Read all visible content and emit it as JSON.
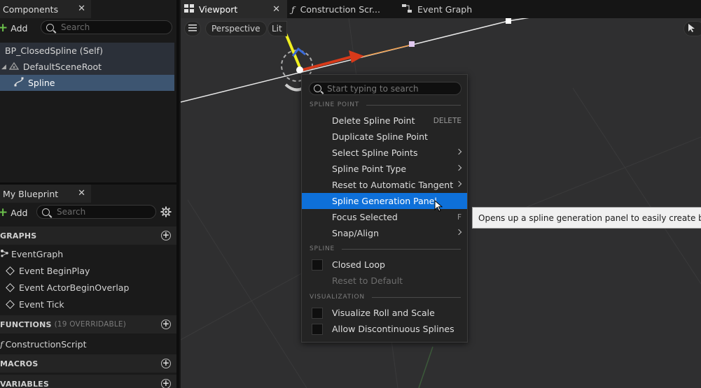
{
  "components_panel": {
    "tab_label": "Components",
    "add_label": "Add",
    "search_placeholder": "Search",
    "tree": [
      {
        "label": "BP_ClosedSpline (Self)"
      },
      {
        "label": "DefaultSceneRoot"
      },
      {
        "label": "Spline"
      }
    ]
  },
  "my_blueprint_panel": {
    "tab_label": "My Blueprint",
    "add_label": "Add",
    "search_placeholder": "Search",
    "sections": {
      "graphs": {
        "label": "GRAPHS",
        "items": [
          "EventGraph"
        ]
      },
      "events": [
        "Event BeginPlay",
        "Event ActorBeginOverlap",
        "Event Tick"
      ],
      "functions": {
        "label": "FUNCTIONS",
        "sublabel": "(19 OVERRIDABLE)",
        "items": [
          "ConstructionScript"
        ]
      },
      "macros": {
        "label": "MACROS"
      },
      "variables": {
        "label": "VARIABLES"
      }
    }
  },
  "editor_tabs": [
    {
      "label": "Viewport",
      "icon": "grid-icon",
      "active": true
    },
    {
      "label": "Construction Scr...",
      "icon": "function-icon",
      "active": false
    },
    {
      "label": "Event Graph",
      "icon": "graph-icon",
      "active": false
    }
  ],
  "viewport_toolbar": {
    "perspective_label": "Perspective",
    "lit_label": "Lit"
  },
  "context_menu": {
    "search_placeholder": "Start typing to search",
    "sections": [
      {
        "label": "SPLINE POINT"
      },
      {
        "label": "SPLINE"
      },
      {
        "label": "VISUALIZATION"
      }
    ],
    "items": {
      "delete": {
        "label": "Delete Spline Point",
        "shortcut": "DELETE"
      },
      "duplicate": {
        "label": "Duplicate Spline Point"
      },
      "select": {
        "label": "Select Spline Points"
      },
      "type": {
        "label": "Spline Point Type"
      },
      "reset_tangent": {
        "label": "Reset to Automatic Tangent"
      },
      "generation_panel": {
        "label": "Spline Generation Panel"
      },
      "focus": {
        "label": "Focus Selected",
        "shortcut": "F"
      },
      "snap": {
        "label": "Snap/Align"
      },
      "closed_loop": {
        "label": "Closed Loop",
        "checked": false
      },
      "reset_default": {
        "label": "Reset to Default"
      },
      "roll_scale": {
        "label": "Visualize Roll and Scale",
        "checked": false
      },
      "discontinuous": {
        "label": "Allow Discontinuous Splines",
        "checked": false
      }
    }
  },
  "tooltip": {
    "text": "Opens up a spline generation panel to easily create basic shap"
  },
  "colors": {
    "accent": "#0e70d9",
    "selection": "#3d5571",
    "add_plus": "#6bc04b"
  }
}
